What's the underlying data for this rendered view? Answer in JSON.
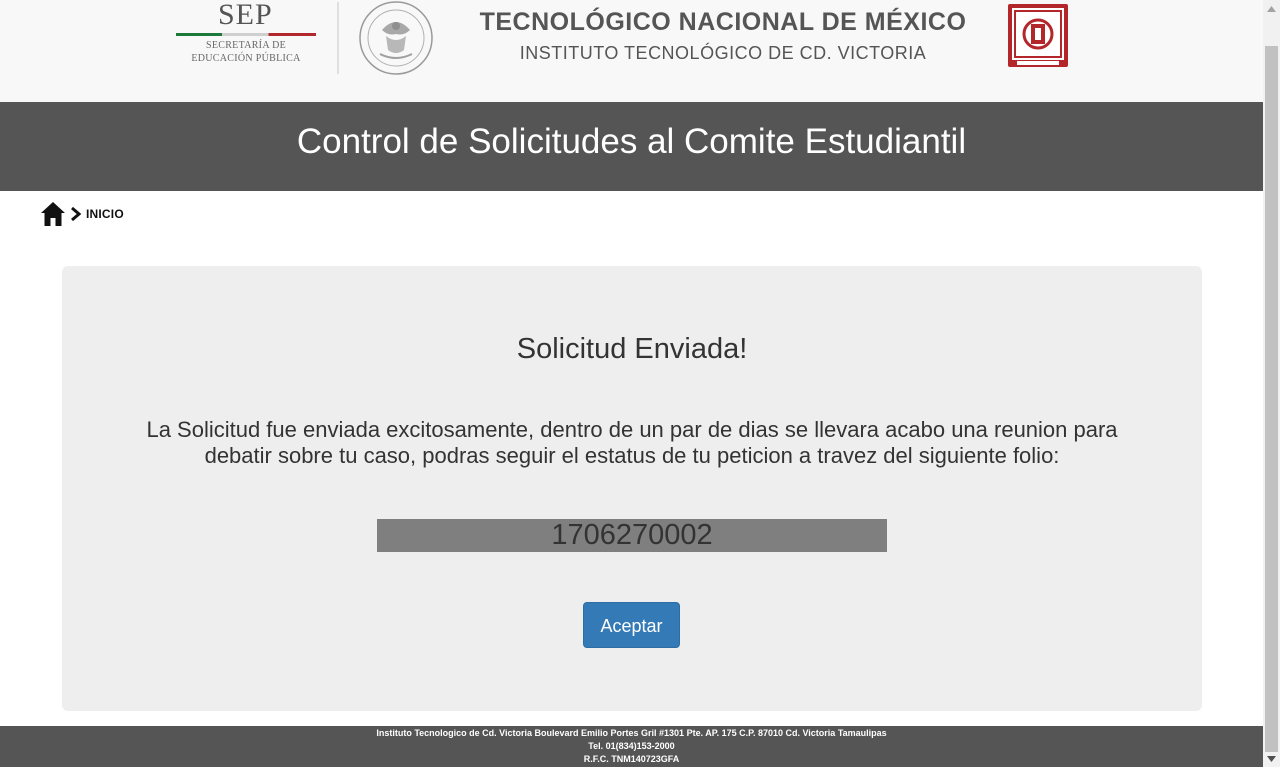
{
  "header": {
    "sep": {
      "word": "SEP",
      "line1": "SECRETARÍA DE",
      "line2": "EDUCACIÓN PÚBLICA"
    },
    "institution_title": "TECNOLÓGICO NACIONAL DE MÉXICO",
    "institution_subtitle": "INSTITUTO TECNOLÓGICO DE  CD. VICTORIA",
    "icons": {
      "seal": "mexican-seal-icon",
      "itcv_logo": "itcv-logo-icon"
    }
  },
  "title_band": {
    "title": "Control de Solicitudes al Comite Estudiantil"
  },
  "breadcrumb": {
    "home_icon": "home-icon",
    "separator_icon": "chevron-right-icon",
    "current": "INICIO"
  },
  "card": {
    "heading": "Solicitud Enviada!",
    "message": "La Solicitud fue enviada excitosamente, dentro de un par de dias se llevara acabo una reunion para debatir sobre tu caso, podras seguir el estatus de tu peticion a travez del siguiente folio:",
    "folio": "1706270002",
    "accept_label": "Aceptar"
  },
  "footer": {
    "address": "Instituto Tecnologico de Cd. Victoria Boulevard Emilio Portes Gril #1301 Pte. AP. 175 C.P. 87010 Cd. Victoria Tamaulipas",
    "phone": "Tel. 01(834)153-2000",
    "rfc": "R.F.C. TNM140723GFA"
  },
  "colors": {
    "header_bg": "#f8f8f8",
    "band_bg": "#555555",
    "card_bg": "#eeeeee",
    "folio_bg": "#7f7f7f",
    "primary_button": "#337ab7",
    "itcv_red": "#b3262a"
  }
}
